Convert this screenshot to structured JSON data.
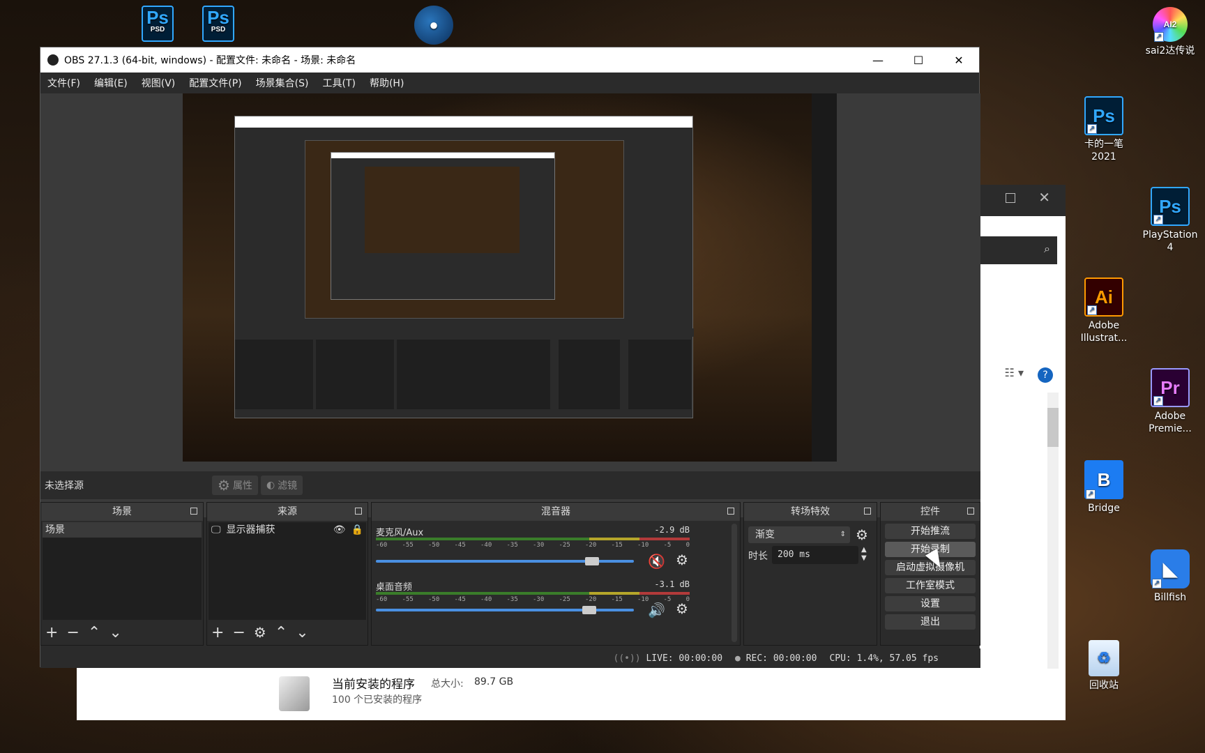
{
  "desktop": {
    "psd1": "PSD",
    "psd2": "PSD",
    "sai2": "sai2达传说",
    "ps_card": "卡的一笔\n2021",
    "ps_playstation": "PlayStation\n4",
    "ai_label": "Adobe\nIllustrat...",
    "pr_label": "Adobe\nPremie...",
    "bridge": "Bridge",
    "billfish": "Billfish",
    "recycle": "回收站",
    "ps_text": "Ps",
    "ai_text": "Ai",
    "pr_text": "Pr"
  },
  "bg_window": {
    "programs_title": "当前安装的程序",
    "total_size_label": "总大小:",
    "total_size": "89.7 GB",
    "count": "100 个已安装的程序"
  },
  "obs": {
    "title": "OBS 27.1.3 (64-bit, windows) - 配置文件: 未命名 - 场景: 未命名",
    "menu": [
      "文件(F)",
      "编辑(E)",
      "视图(V)",
      "配置文件(P)",
      "场景集合(S)",
      "工具(T)",
      "帮助(H)"
    ],
    "no_source": "未选择源",
    "properties": "属性",
    "filters": "滤镜",
    "docks": {
      "scenes": {
        "title": "场景",
        "items": [
          "场景"
        ]
      },
      "sources": {
        "title": "来源",
        "items": [
          "显示器捕获"
        ]
      },
      "mixer": {
        "title": "混音器",
        "channels": [
          {
            "name": "麦克风/Aux",
            "db": "-2.9 dB"
          },
          {
            "name": "桌面音频",
            "db": "-3.1 dB"
          }
        ],
        "scale": [
          "-60",
          "-55",
          "-50",
          "-45",
          "-40",
          "-35",
          "-30",
          "-25",
          "-20",
          "-15",
          "-10",
          "-5",
          "0"
        ]
      },
      "transitions": {
        "title": "转场特效",
        "type": "渐变",
        "duration_label": "时长",
        "duration": "200 ms"
      },
      "controls": {
        "title": "控件",
        "buttons": [
          "开始推流",
          "开始录制",
          "启动虚拟摄像机",
          "工作室模式",
          "设置",
          "退出"
        ]
      }
    },
    "status": {
      "live": "LIVE: 00:00:00",
      "rec": "REC: 00:00:00",
      "cpu": "CPU: 1.4%, 57.05 fps"
    }
  }
}
